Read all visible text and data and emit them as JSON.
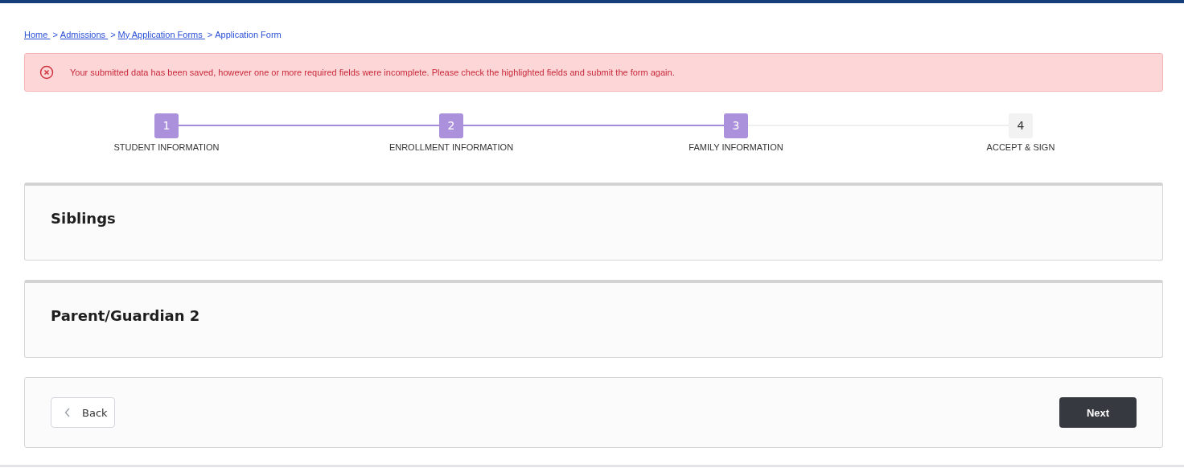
{
  "breadcrumbs": [
    {
      "label": "Home ",
      "link": true
    },
    {
      "label": "Admissions ",
      "link": true
    },
    {
      "label": "My Application Forms ",
      "link": true
    },
    {
      "label": "Application Form",
      "link": false
    }
  ],
  "breadcrumb_separator": ">",
  "alert": {
    "message": "Your submitted data has been saved, however one or more required fields were incomplete. Please check the highlighted fields and submit the form again."
  },
  "steps": [
    {
      "number": "1",
      "label": "STUDENT INFORMATION",
      "completed": true
    },
    {
      "number": "2",
      "label": "ENROLLMENT INFORMATION",
      "completed": true
    },
    {
      "number": "3",
      "label": "FAMILY INFORMATION",
      "completed": true
    },
    {
      "number": "4",
      "label": "ACCEPT & SIGN",
      "completed": false
    }
  ],
  "sections": [
    {
      "title": "Siblings"
    },
    {
      "title": "Parent/Guardian 2"
    }
  ],
  "buttons": {
    "back": "Back",
    "next": "Next"
  }
}
